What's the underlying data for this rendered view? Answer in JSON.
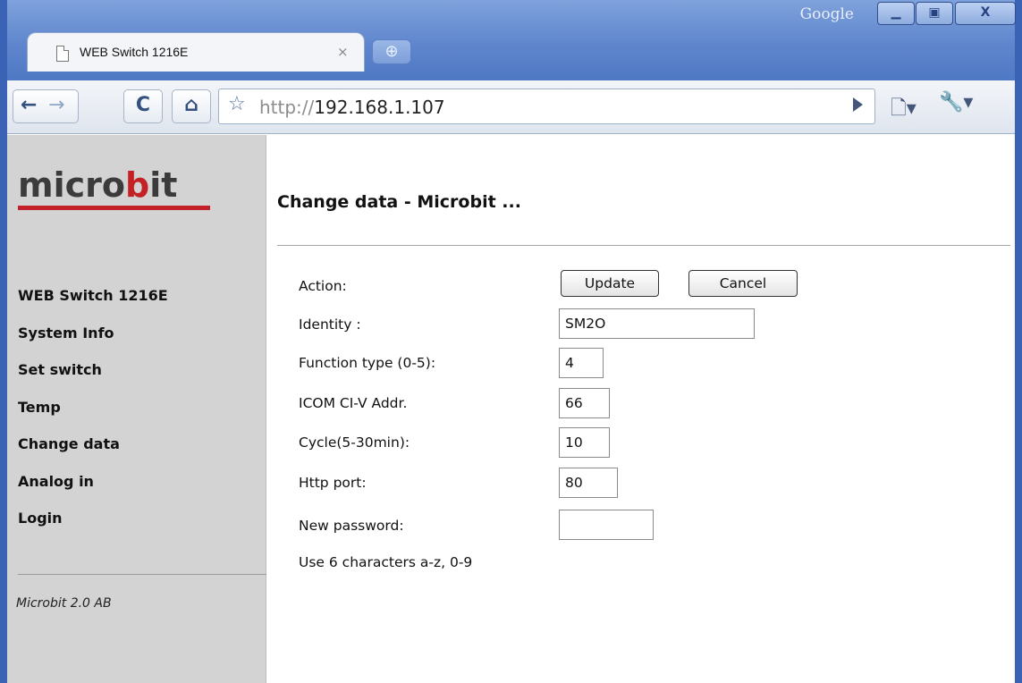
{
  "window": {
    "brand": "Google",
    "minimize_glyph": "▁",
    "maximize_glyph": "▣",
    "close_glyph": "X"
  },
  "tab": {
    "title": "WEB Switch 1216E",
    "close_glyph": "×",
    "newtab_glyph": "⊕"
  },
  "toolbar": {
    "back_glyph": "←",
    "forward_glyph": "→",
    "reload_glyph": "C",
    "home_glyph": "⌂",
    "star_glyph": "☆",
    "url_scheme": "http://",
    "url_host": "192.168.1.107",
    "page_menu_glyph": "🗋▾",
    "wrench_menu_glyph": "🔧▾"
  },
  "sidebar": {
    "logo_left": "micro",
    "logo_accent": "b",
    "logo_right": "it",
    "items": [
      {
        "label": "WEB Switch 1216E"
      },
      {
        "label": "System Info"
      },
      {
        "label": "Set switch"
      },
      {
        "label": "Temp"
      },
      {
        "label": "Change data"
      },
      {
        "label": "Analog in"
      },
      {
        "label": "Login"
      }
    ],
    "copyright": "Microbit 2.0 AB"
  },
  "main": {
    "title": "Change data - Microbit ..."
  },
  "form": {
    "action_label": "Action:",
    "update_label": "Update",
    "cancel_label": "Cancel",
    "identity_label": "Identity :",
    "identity_value": "SM2O",
    "function_label": "Function type (0-5):",
    "function_value": "4",
    "icom_label": "ICOM CI-V Addr.",
    "icom_value": "66",
    "cycle_label": "Cycle(5-30min):",
    "cycle_value": "10",
    "http_label": "Http port:",
    "http_value": "80",
    "password_label": "New password:",
    "password_value": "",
    "password_hint": "Use 6 characters a-z, 0-9"
  },
  "colors": {
    "chrome_blue": "#5f86cd",
    "sidebar_gray": "#d3d3d3",
    "logo_red": "#c32126"
  }
}
